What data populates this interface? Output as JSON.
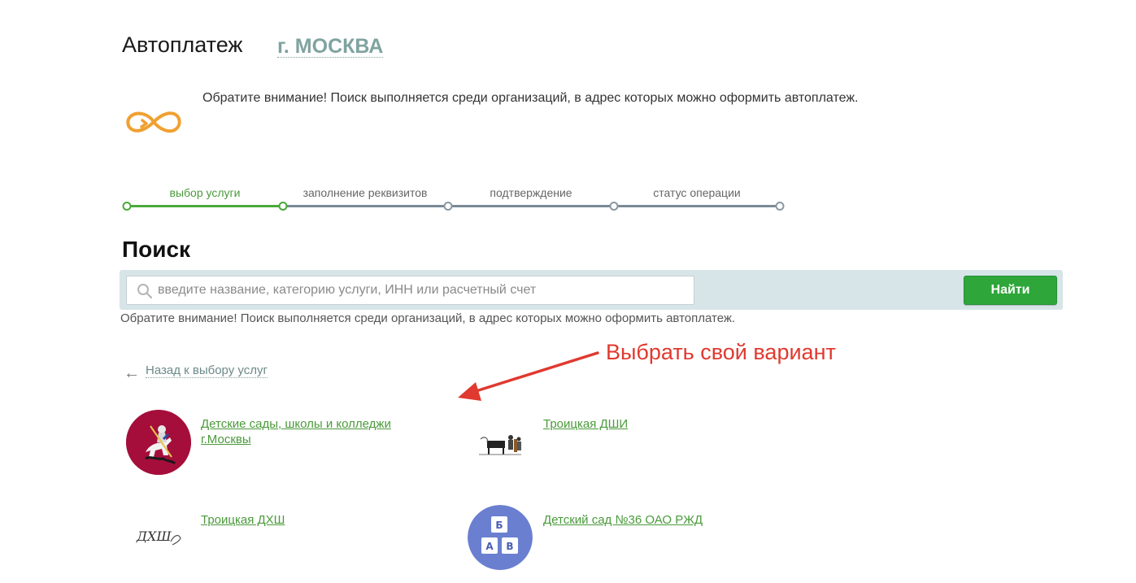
{
  "header": {
    "title": "Автоплатеж",
    "region": "г. МОСКВА"
  },
  "notice_top": "Обратите внимание! Поиск выполняется среди организаций, в адрес которых можно оформить автоплатеж.",
  "steps": [
    {
      "label": "выбор услуги",
      "active": true
    },
    {
      "label": "заполнение реквизитов",
      "active": false
    },
    {
      "label": "подтверждение",
      "active": false
    },
    {
      "label": "статус операции",
      "active": false
    }
  ],
  "search": {
    "heading": "Поиск",
    "placeholder": "введите название, категорию услуги, ИНН или расчетный счет",
    "value": "",
    "button_label": "Найти",
    "notice": "Обратите внимание! Поиск выполняется среди организаций, в адрес которых можно оформить автоплатеж."
  },
  "back_link": {
    "arrow": "←",
    "label": "Назад к выбору услуг"
  },
  "annotation": {
    "text": "Выбрать свой вариант",
    "color": "#e0392f"
  },
  "results": [
    {
      "line1": "Детские сады, школы и колледжи",
      "line2": "г.Москвы",
      "logo": "moscow-coat-of-arms"
    },
    {
      "line1": "Троицкая ДШИ",
      "line2": "",
      "logo": "piano-musicians"
    },
    {
      "line1": "Троицкая ДХШ",
      "line2": "",
      "logo": "dhsh-signature",
      "logo_text": "ДХШ"
    },
    {
      "line1": "Детский сад №36 ОАО РЖД",
      "line2": "",
      "logo": "alphabet-blocks",
      "blocks": [
        "Б",
        "А",
        "В"
      ]
    }
  ],
  "colors": {
    "accent_green": "#4aa83a",
    "button_green": "#2ea63a",
    "search_bar_bg": "#d7e5e8",
    "region_color": "#7fa3a0",
    "link_green": "#4a9a3a"
  }
}
